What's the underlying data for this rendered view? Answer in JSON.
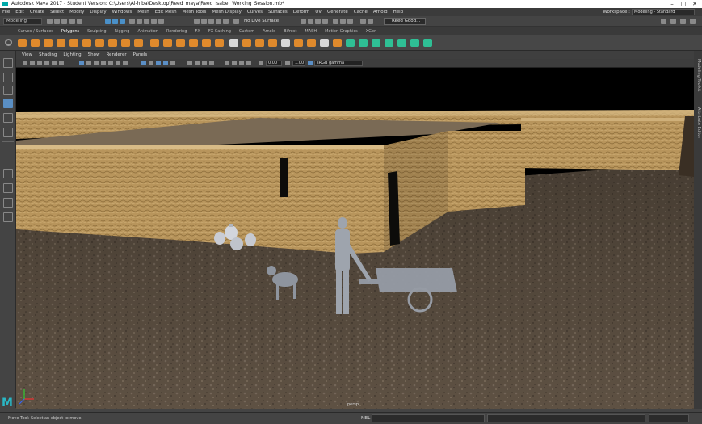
{
  "window": {
    "title": "Autodesk Maya 2017 - Student Version: C:\\Users\\Al-hiba\\Desktop\\Reed_maya\\Reed_Isabel_Working_Session.mb*",
    "minimize": "–",
    "maximize": "□",
    "close": "✕"
  },
  "menubar": {
    "items": [
      "File",
      "Edit",
      "Create",
      "Select",
      "Modify",
      "Display",
      "Windows",
      "Mesh",
      "Edit Mesh",
      "Mesh Tools",
      "Mesh Display",
      "Curves",
      "Surfaces",
      "Deform",
      "UV",
      "Generate",
      "Cache",
      "Arnold",
      "Help"
    ],
    "workspace_label": "Workspace :",
    "workspace_value": "Modeling - Standard"
  },
  "statusline": {
    "mode": "Modeling",
    "live_surface": "No Live Surface",
    "mesh_field": "Reed Good..."
  },
  "shelf": {
    "tabs": [
      "Curves / Surfaces",
      "Polygons",
      "Sculpting",
      "Rigging",
      "Animation",
      "Rendering",
      "FX",
      "FX Caching",
      "Custom",
      "Arnold",
      "Bifrost",
      "MASH",
      "Motion Graphics",
      "XGen"
    ],
    "active_tab": "Polygons"
  },
  "panel": {
    "menus": [
      "View",
      "Shading",
      "Lighting",
      "Show",
      "Renderer",
      "Panels"
    ],
    "field_1": "0.00",
    "field_2": "1.00",
    "color_space": "sRGB gamma"
  },
  "viewport": {
    "camera_label": "persp"
  },
  "right_tabs": [
    "Modeling Toolkit",
    "Attribute Editor"
  ],
  "helpline": {
    "message": "Move Tool: Select an object to move.",
    "mel_label": "MEL"
  },
  "logo": "M",
  "colors": {
    "accent": "#5a8fc4",
    "sky": "#000000",
    "wall": "#b8935a",
    "ground": "#5f5244"
  }
}
